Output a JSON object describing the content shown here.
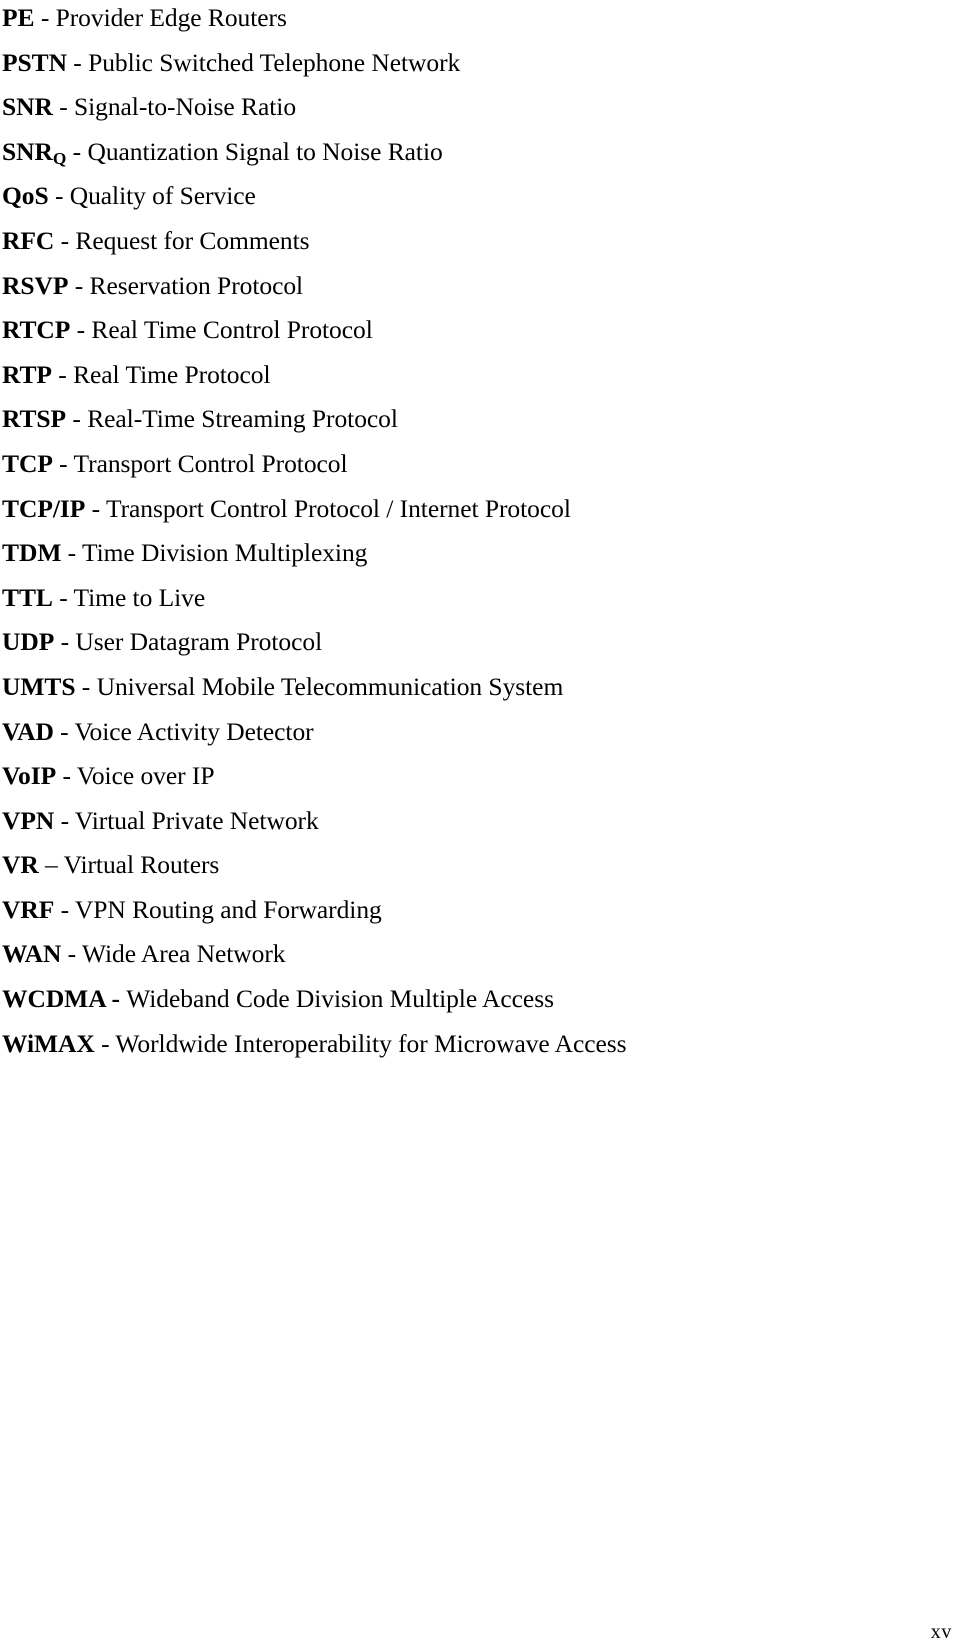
{
  "document": {
    "section_kind": "abbreviations-glossary",
    "folio": "xv"
  },
  "glossary": {
    "entries": [
      {
        "abbr": "PE",
        "sub": "",
        "sep": " - ",
        "sep_bold": false,
        "defn": "Provider Edge Routers"
      },
      {
        "abbr": "PSTN",
        "sub": "",
        "sep": " - ",
        "sep_bold": false,
        "defn": "Public Switched Telephone Network"
      },
      {
        "abbr": "SNR",
        "sub": "",
        "sep": " - ",
        "sep_bold": false,
        "defn": "Signal-to-Noise Ratio"
      },
      {
        "abbr": "SNR",
        "sub": "Q",
        "sep": " - ",
        "sep_bold": false,
        "defn": "Quantization Signal to Noise Ratio"
      },
      {
        "abbr": "QoS",
        "sub": "",
        "sep": " - ",
        "sep_bold": false,
        "defn": "Quality of Service"
      },
      {
        "abbr": "RFC",
        "sub": "",
        "sep": " - ",
        "sep_bold": false,
        "defn": "Request for Comments"
      },
      {
        "abbr": "RSVP",
        "sub": "",
        "sep": " - ",
        "sep_bold": false,
        "defn": "Reservation Protocol"
      },
      {
        "abbr": "RTCP",
        "sub": "",
        "sep": " - ",
        "sep_bold": false,
        "defn": "Real Time Control Protocol"
      },
      {
        "abbr": "RTP",
        "sub": "",
        "sep": " - ",
        "sep_bold": false,
        "defn": "Real Time Protocol"
      },
      {
        "abbr": "RTSP",
        "sub": "",
        "sep": " - ",
        "sep_bold": false,
        "defn": "Real-Time Streaming Protocol"
      },
      {
        "abbr": "TCP",
        "sub": "",
        "sep": " - ",
        "sep_bold": false,
        "defn": "Transport Control Protocol"
      },
      {
        "abbr": "TCP/IP",
        "sub": "",
        "sep": " - ",
        "sep_bold": false,
        "defn": "Transport Control Protocol / Internet Protocol"
      },
      {
        "abbr": "TDM",
        "sub": "",
        "sep": " - ",
        "sep_bold": false,
        "defn": "Time Division Multiplexing"
      },
      {
        "abbr": "TTL",
        "sub": "",
        "sep": " - ",
        "sep_bold": false,
        "defn": "Time to Live"
      },
      {
        "abbr": "UDP",
        "sub": "",
        "sep": " - ",
        "sep_bold": false,
        "defn": "User Datagram Protocol"
      },
      {
        "abbr": "UMTS",
        "sub": "",
        "sep": " - ",
        "sep_bold": false,
        "defn": "Universal Mobile Telecommunication System"
      },
      {
        "abbr": "VAD",
        "sub": "",
        "sep": " - ",
        "sep_bold": false,
        "defn": "Voice Activity Detector"
      },
      {
        "abbr": "VoIP",
        "sub": "",
        "sep": " - ",
        "sep_bold": false,
        "defn": "Voice over IP"
      },
      {
        "abbr": "VPN",
        "sub": "",
        "sep": " - ",
        "sep_bold": false,
        "defn": "Virtual Private Network"
      },
      {
        "abbr": "VR",
        "sub": "",
        "sep": " – ",
        "sep_bold": false,
        "defn": "Virtual Routers"
      },
      {
        "abbr": "VRF",
        "sub": "",
        "sep": " - ",
        "sep_bold": false,
        "defn": "VPN Routing and Forwarding"
      },
      {
        "abbr": "WAN",
        "sub": "",
        "sep": " - ",
        "sep_bold": false,
        "defn": "Wide Area Network"
      },
      {
        "abbr": "WCDMA",
        "sub": "",
        "sep": " - ",
        "sep_bold": true,
        "defn": "Wideband Code Division Multiple Access"
      },
      {
        "abbr": "WiMAX",
        "sub": "",
        "sep": " - ",
        "sep_bold": false,
        "defn": "Worldwide Interoperability for Microwave Access"
      }
    ]
  }
}
